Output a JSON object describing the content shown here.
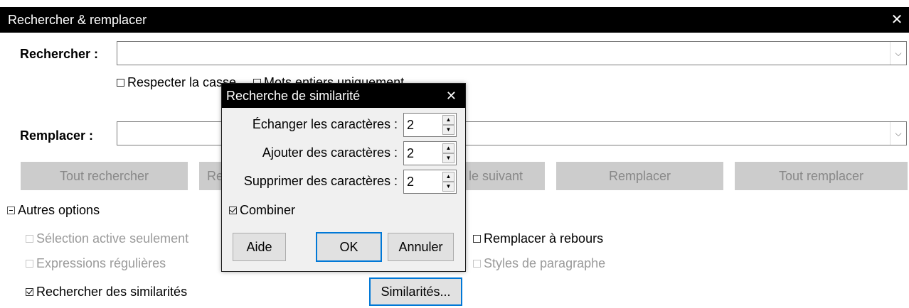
{
  "window": {
    "title": "Rechercher & remplacer",
    "close_glyph": "✕"
  },
  "search": {
    "label": "Rechercher :",
    "value": "",
    "dropdown_glyph": "⌵"
  },
  "options_row1": {
    "match_case": "Respecter la casse",
    "whole_words": "Mots entiers uniquement"
  },
  "replace": {
    "label": "Remplacer :",
    "value": "",
    "dropdown_glyph": "⌵"
  },
  "buttons": {
    "find_all": "Tout rechercher",
    "find_prev_partial": "Re",
    "find_next_partial": "le suivant",
    "replace": "Remplacer",
    "replace_all": "Tout remplacer"
  },
  "other_options": {
    "label": "Autres options",
    "active_selection": "Sélection active seulement",
    "regex": "Expressions régulières",
    "similarity": "Rechercher des similarités",
    "replace_backwards": "Remplacer à rebours",
    "paragraph_styles": "Styles de paragraphe",
    "similarities_button": "Similarités..."
  },
  "similarity_dialog": {
    "title": "Recherche de similarité",
    "close_glyph": "✕",
    "exchange_label": "Échanger les caractères :",
    "exchange_value": "2",
    "add_label": "Ajouter des caractères :",
    "add_value": "2",
    "remove_label": "Supprimer des caractères :",
    "remove_value": "2",
    "combine_label": "Combiner",
    "help_button": "Aide",
    "ok_button": "OK",
    "cancel_button": "Annuler"
  },
  "icons": {
    "spin_up": "▲",
    "spin_down": "▼"
  }
}
